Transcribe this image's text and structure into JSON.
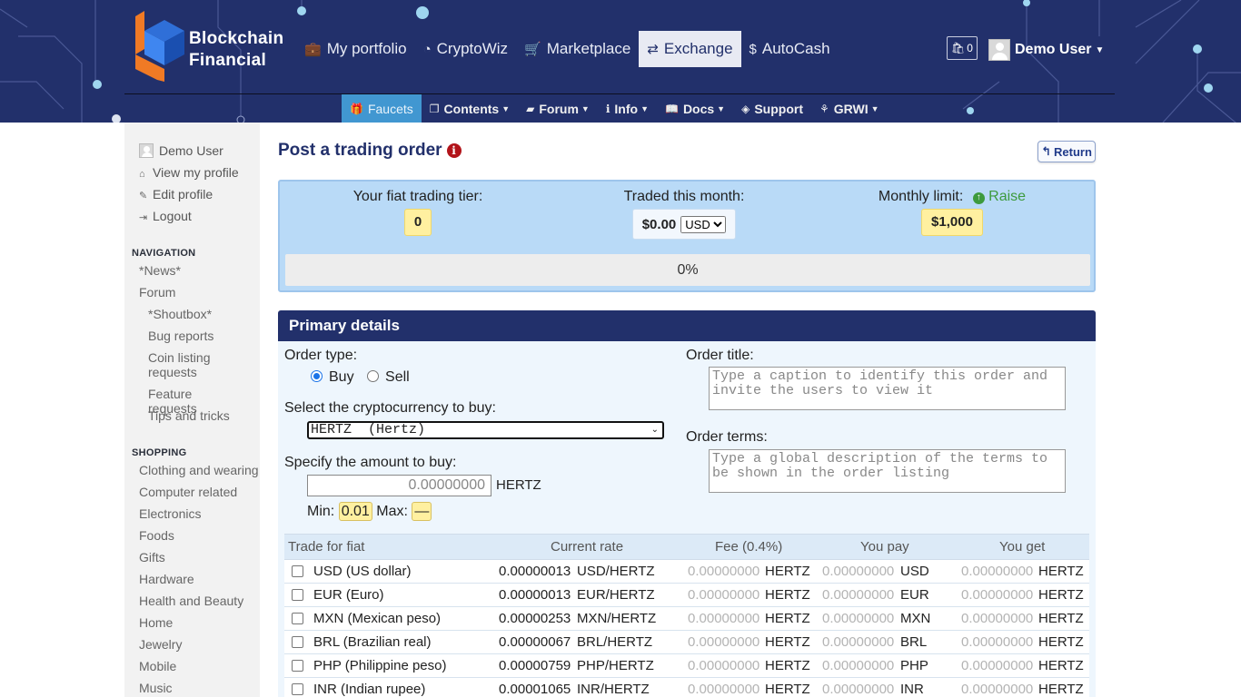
{
  "brand": {
    "line1": "Blockchain",
    "line2": "Financial"
  },
  "topnav": [
    {
      "icon": "briefcase-icon",
      "glyph": "💼",
      "label": "My portfolio",
      "active": false
    },
    {
      "icon": "dashboard-icon",
      "glyph": "◔",
      "label": "CryptoWiz",
      "active": false
    },
    {
      "icon": "cart-icon",
      "glyph": "🛒",
      "label": "Marketplace",
      "active": false
    },
    {
      "icon": "exchange-icon",
      "glyph": "⇄",
      "label": "Exchange",
      "active": true
    },
    {
      "icon": "dollar-icon",
      "glyph": "$",
      "label": "AutoCash",
      "active": false
    }
  ],
  "cart": {
    "count": "0"
  },
  "user": {
    "name": "Demo User"
  },
  "subnav": [
    {
      "icon": "gift-icon",
      "glyph": "🎁",
      "label": "Faucets",
      "active": true,
      "dropdown": false
    },
    {
      "icon": "contents-icon",
      "glyph": "❐",
      "label": "Contents",
      "active": false,
      "dropdown": true
    },
    {
      "icon": "folder-icon",
      "glyph": "▰",
      "label": "Forum",
      "active": false,
      "dropdown": true
    },
    {
      "icon": "info-icon",
      "glyph": "ℹ",
      "label": "Info",
      "active": false,
      "dropdown": true
    },
    {
      "icon": "book-icon",
      "glyph": "📖",
      "label": "Docs",
      "active": false,
      "dropdown": true
    },
    {
      "icon": "support-icon",
      "glyph": "◈",
      "label": "Support",
      "active": false,
      "dropdown": false
    },
    {
      "icon": "grwi-icon",
      "glyph": "⚘",
      "label": "GRWI",
      "active": false,
      "dropdown": true
    }
  ],
  "sidebar": {
    "user_name": "Demo User",
    "links": [
      {
        "icon": "home-icon",
        "glyph": "⌂",
        "label": "View my profile"
      },
      {
        "icon": "pencil-icon",
        "glyph": "✎",
        "label": "Edit profile"
      },
      {
        "icon": "logout-icon",
        "glyph": "⇥",
        "label": "Logout"
      }
    ],
    "navigation_heading": "NAVIGATION",
    "navigation": [
      {
        "label": "*News*",
        "level": 1
      },
      {
        "label": "Forum",
        "level": 1
      },
      {
        "label": "*Shoutbox*",
        "level": 2
      },
      {
        "label": "Bug reports",
        "level": 2
      },
      {
        "label": "Coin listing requests",
        "level": 2
      },
      {
        "label": "Feature requests",
        "level": 2
      },
      {
        "label": "Tips and tricks",
        "level": 2
      }
    ],
    "shopping_heading": "SHOPPING",
    "shopping": [
      "Clothing and wearing",
      "Computer related",
      "Electronics",
      "Foods",
      "Gifts",
      "Hardware",
      "Health and Beauty",
      "Home",
      "Jewelry",
      "Mobile",
      "Music"
    ]
  },
  "page": {
    "title": "Post a trading order",
    "return_label": "Return"
  },
  "tier": {
    "fiat_tier_label": "Your fiat trading tier:",
    "fiat_tier_value": "0",
    "traded_label": "Traded this month:",
    "traded_value": "$0.00",
    "traded_currency": "USD",
    "monthly_limit_label": "Monthly limit:",
    "raise_label": "Raise",
    "monthly_limit_value": "$1,000",
    "progress_text": "0%",
    "progress_fraction": 0
  },
  "primary": {
    "heading": "Primary details",
    "order_type_label": "Order type:",
    "buy_label": "Buy",
    "sell_label": "Sell",
    "select_crypto_label": "Select the cryptocurrency to buy:",
    "selected_crypto": "HERTZ  (Hertz)",
    "amount_label": "Specify the amount to buy:",
    "amount_placeholder": "0.00000000",
    "amount_unit": "HERTZ",
    "min_label": "Min:",
    "min_value": "0.01",
    "max_label": "Max:",
    "max_value": "—",
    "order_title_label": "Order title:",
    "order_title_placeholder": "Type a caption to identify this order and invite the users to view it",
    "order_terms_label": "Order terms:",
    "order_terms_placeholder": "Type a global description of the terms to be shown in the order listing"
  },
  "table": {
    "headers": [
      "Trade for fiat",
      "Current rate",
      "Fee (0.4%)",
      "You pay",
      "You get"
    ],
    "rows": [
      {
        "fiat": "USD (US dollar)",
        "rate": "0.00000013",
        "pair": "USD/HERTZ",
        "fee": "0.00000000",
        "fee_unit": "HERTZ",
        "pay": "0.00000000",
        "pay_unit": "USD",
        "get": "0.00000000",
        "get_unit": "HERTZ"
      },
      {
        "fiat": "EUR (Euro)",
        "rate": "0.00000013",
        "pair": "EUR/HERTZ",
        "fee": "0.00000000",
        "fee_unit": "HERTZ",
        "pay": "0.00000000",
        "pay_unit": "EUR",
        "get": "0.00000000",
        "get_unit": "HERTZ"
      },
      {
        "fiat": "MXN (Mexican peso)",
        "rate": "0.00000253",
        "pair": "MXN/HERTZ",
        "fee": "0.00000000",
        "fee_unit": "HERTZ",
        "pay": "0.00000000",
        "pay_unit": "MXN",
        "get": "0.00000000",
        "get_unit": "HERTZ"
      },
      {
        "fiat": "BRL (Brazilian real)",
        "rate": "0.00000067",
        "pair": "BRL/HERTZ",
        "fee": "0.00000000",
        "fee_unit": "HERTZ",
        "pay": "0.00000000",
        "pay_unit": "BRL",
        "get": "0.00000000",
        "get_unit": "HERTZ"
      },
      {
        "fiat": "PHP (Philippine peso)",
        "rate": "0.00000759",
        "pair": "PHP/HERTZ",
        "fee": "0.00000000",
        "fee_unit": "HERTZ",
        "pay": "0.00000000",
        "pay_unit": "PHP",
        "get": "0.00000000",
        "get_unit": "HERTZ"
      },
      {
        "fiat": "INR (Indian rupee)",
        "rate": "0.00001065",
        "pair": "INR/HERTZ",
        "fee": "0.00000000",
        "fee_unit": "HERTZ",
        "pay": "0.00000000",
        "pay_unit": "INR",
        "get": "0.00000000",
        "get_unit": "HERTZ"
      }
    ]
  },
  "colors": {
    "header_bg": "#22306b",
    "accent_blue": "#4197d1",
    "tier_bg": "#b9daf7",
    "chip_yellow": "#fff0a0",
    "raise_green": "#3d9a3d",
    "info_red": "#b2141a"
  }
}
